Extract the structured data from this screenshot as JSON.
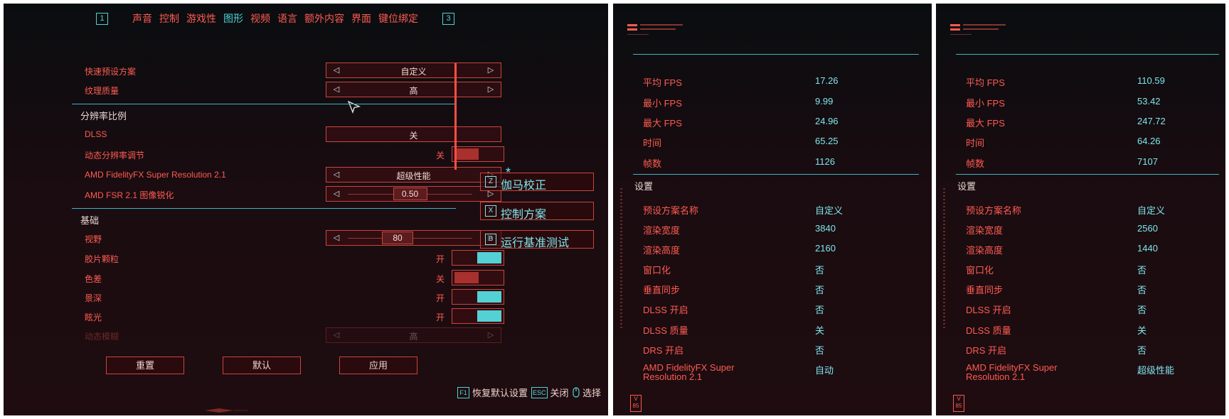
{
  "tabs": {
    "left_key": "1",
    "right_key": "3",
    "items": [
      "声音",
      "控制",
      "游戏性",
      "图形",
      "视频",
      "语言",
      "额外内容",
      "界面",
      "键位绑定"
    ],
    "active": "图形"
  },
  "settings": {
    "rows": [
      {
        "label": "快速预设方案",
        "value": "自定义"
      },
      {
        "label": "纹理质量",
        "value": "高"
      }
    ],
    "resolution_section": "分辨率比例",
    "dlss": {
      "label": "DLSS",
      "value": "关"
    },
    "dynamic_res": {
      "label": "动态分辨率调节",
      "state_text": "关",
      "on": false
    },
    "fsr": {
      "label": "AMD FidelityFX Super Resolution 2.1",
      "value": "超级性能",
      "marker": "*"
    },
    "fsr_sharpen": {
      "label": "AMD FSR 2.1 图像锐化",
      "value": "0.50",
      "fraction": 0.5
    },
    "basic_section": "基础",
    "fov": {
      "label": "视野",
      "value": "80",
      "fraction": 0.4
    },
    "film_grain": {
      "label": "胶片颗粒",
      "state_text": "开",
      "on": true
    },
    "chromatic": {
      "label": "色差",
      "state_text": "关",
      "on": false
    },
    "dof": {
      "label": "景深",
      "state_text": "开",
      "on": true
    },
    "lens_flare": {
      "label": "眩光",
      "state_text": "开",
      "on": true
    },
    "motion_blur": {
      "label": "动态模糊",
      "value": "高"
    }
  },
  "side_buttons": [
    {
      "key": "Z",
      "label": "伽马校正"
    },
    {
      "key": "X",
      "label": "控制方案"
    },
    {
      "key": "B",
      "label": "运行基准测试"
    }
  ],
  "bottom_buttons": {
    "reset": "重置",
    "default": "默认",
    "apply": "应用"
  },
  "footer": {
    "restore_key": "F1",
    "restore_label": "恢复默认设置",
    "close_key": "ESC",
    "close_label": "关闭",
    "select_label": "选择"
  },
  "bench_a": {
    "stats": [
      {
        "label": "平均 FPS",
        "value": "17.26"
      },
      {
        "label": "最小 FPS",
        "value": "9.99"
      },
      {
        "label": "最大 FPS",
        "value": "24.96"
      },
      {
        "label": "时间",
        "value": "65.25"
      },
      {
        "label": "帧数",
        "value": "1126"
      }
    ],
    "settings_title": "设置",
    "settings": [
      {
        "label": "预设方案名称",
        "value": "自定义"
      },
      {
        "label": "渲染宽度",
        "value": "3840"
      },
      {
        "label": "渲染高度",
        "value": "2160"
      },
      {
        "label": "窗口化",
        "value": "否"
      },
      {
        "label": "垂直同步",
        "value": "否"
      },
      {
        "label": "DLSS 开启",
        "value": "否"
      },
      {
        "label": "DLSS 质量",
        "value": "关"
      },
      {
        "label": "DRS 开启",
        "value": "否"
      },
      {
        "label": "AMD FidelityFX Super Resolution 2.1",
        "value": "自动"
      }
    ]
  },
  "bench_b": {
    "stats": [
      {
        "label": "平均 FPS",
        "value": "110.59"
      },
      {
        "label": "最小 FPS",
        "value": "53.42"
      },
      {
        "label": "最大 FPS",
        "value": "247.72"
      },
      {
        "label": "时间",
        "value": "64.26"
      },
      {
        "label": "帧数",
        "value": "7107"
      }
    ],
    "settings_title": "设置",
    "settings": [
      {
        "label": "预设方案名称",
        "value": "自定义"
      },
      {
        "label": "渲染宽度",
        "value": "2560"
      },
      {
        "label": "渲染高度",
        "value": "1440"
      },
      {
        "label": "窗口化",
        "value": "否"
      },
      {
        "label": "垂直同步",
        "value": "否"
      },
      {
        "label": "DLSS 开启",
        "value": "否"
      },
      {
        "label": "DLSS 质量",
        "value": "关"
      },
      {
        "label": "DRS 开启",
        "value": "否"
      },
      {
        "label": "AMD FidelityFX Super Resolution 2.1",
        "value": "超级性能"
      }
    ]
  },
  "badge": {
    "top": "V",
    "bottom": "85"
  },
  "colors": {
    "accent_red": "#ff5b52",
    "accent_cyan": "#4fd3d3",
    "toggle_on": "#54d1d5",
    "toggle_off": "#a8302d"
  }
}
